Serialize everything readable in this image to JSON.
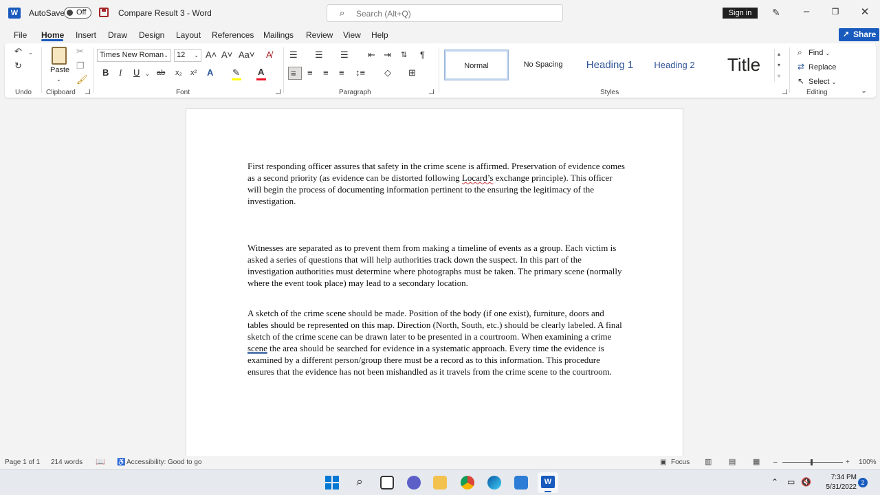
{
  "titlebar": {
    "app_icon": "W",
    "autosave_label": "AutoSave",
    "autosave_state": "Off",
    "doc_title": "Compare Result 3  -  Word",
    "search_placeholder": "Search (Alt+Q)",
    "signin_label": "Sign in"
  },
  "menu": {
    "tabs": [
      "File",
      "Home",
      "Insert",
      "Draw",
      "Design",
      "Layout",
      "References",
      "Mailings",
      "Review",
      "View",
      "Help"
    ],
    "share_label": "Share"
  },
  "ribbon": {
    "groups": {
      "undo": "Undo",
      "clipboard": "Clipboard",
      "font": "Font",
      "paragraph": "Paragraph",
      "styles": "Styles",
      "editing": "Editing"
    },
    "paste_label": "Paste",
    "font_name": "Times New Roman",
    "font_size": "12",
    "case_label": "Aa",
    "styles": [
      "Normal",
      "No Spacing",
      "Heading 1",
      "Heading 2",
      "Title"
    ],
    "editing_items": [
      "Find",
      "Replace",
      "Select"
    ],
    "accent_color": "#185abd"
  },
  "document": {
    "p1": {
      "before": "First responding officer assures that safety in the crime scene is affirmed. Preservation of evidence comes as a second priority (as evidence can be distorted following ",
      "flagged": "Locard’s",
      "after": " exchange principle). This officer will begin the process of documenting information pertinent to the ensuring the legitimacy of the investigation."
    },
    "p2": "Witnesses are separated as to prevent them from making a timeline of events as a group. Each victim is asked a series of questions that will help authorities track down the suspect. In this part of the investigation authorities must determine where photographs must be taken. The primary scene (normally where the event took place) may lead to a secondary location.",
    "p3": {
      "before": "A sketch of the crime scene should be made. Position of the body (if one exist), furniture, doors and tables should be represented on this map. Direction (North, South, etc.) should be clearly labeled. A final sketch of the crime scene can be drawn later to be presented in a courtroom. When examining a crime ",
      "flagged": "scene",
      "after": " the area should be searched for evidence in a systematic approach. Every time the evidence is examined by a different person/group there must be a record as to this information. This procedure ensures that the evidence has not been mishandled as it travels from the crime scene to the courtroom."
    }
  },
  "status": {
    "page": "Page 1 of 1",
    "words": "214 words",
    "accessibility": "Accessibility: Good to go",
    "focus": "Focus",
    "zoom": "100%"
  },
  "taskbar": {
    "time": "7:34 PM",
    "date": "5/31/2022",
    "notifications": "2"
  }
}
